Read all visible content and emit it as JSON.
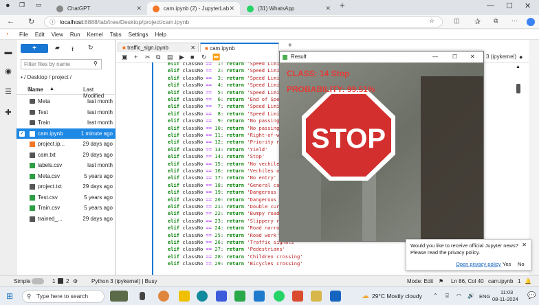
{
  "browser": {
    "tabs": [
      {
        "label": "ChatGPT",
        "active": false
      },
      {
        "label": "cam.ipynb (2) - JupyterLab",
        "active": true
      },
      {
        "label": "(31) WhatsApp",
        "active": false
      }
    ],
    "url_host": "localhost",
    "url_path": ":8888/lab/tree/Desktop/project/cam.ipynb"
  },
  "menu": [
    "File",
    "Edit",
    "View",
    "Run",
    "Kernel",
    "Tabs",
    "Settings",
    "Help"
  ],
  "filebrowser": {
    "new_label": "+",
    "filter_placeholder": "Filter files by name",
    "breadcrumb": "/ Desktop / project /",
    "col_name": "Name",
    "col_modified": "Last Modified",
    "files": [
      {
        "name": "Meta",
        "modified": "last month",
        "type": "folder",
        "selected": false
      },
      {
        "name": "Test",
        "modified": "last month",
        "type": "folder",
        "selected": false
      },
      {
        "name": "Train",
        "modified": "last month",
        "type": "folder",
        "selected": false
      },
      {
        "name": "cam.ipynb",
        "modified": "1 minute ago",
        "type": "notebook",
        "selected": true
      },
      {
        "name": "project.ip...",
        "modified": "29 days ago",
        "type": "notebook",
        "selected": false
      },
      {
        "name": "cam.txt",
        "modified": "29 days ago",
        "type": "text",
        "selected": false
      },
      {
        "name": "labels.csv",
        "modified": "last month",
        "type": "csv",
        "selected": false
      },
      {
        "name": "Meta.csv",
        "modified": "5 years ago",
        "type": "csv",
        "selected": false
      },
      {
        "name": "project.txt",
        "modified": "29 days ago",
        "type": "text",
        "selected": false
      },
      {
        "name": "Test.csv",
        "modified": "5 years ago",
        "type": "csv",
        "selected": false
      },
      {
        "name": "Train.csv",
        "modified": "5 years ago",
        "type": "csv",
        "selected": false
      },
      {
        "name": "trained_...",
        "modified": "29 days ago",
        "type": "text",
        "selected": false
      }
    ]
  },
  "notebook": {
    "tabs": [
      "traffic_sign.ipynb",
      "cam.ipynb"
    ],
    "kernel_label": "3 (ipykernel)",
    "code_lines": [
      {
        "n": "1",
        "label": "'Speed Limit 30"
      },
      {
        "n": "2",
        "label": "'Speed Limit 50"
      },
      {
        "n": "3",
        "label": "'Speed Limit 60"
      },
      {
        "n": "4",
        "label": "'Speed Limit 70"
      },
      {
        "n": "5",
        "label": "'Speed Limit 80"
      },
      {
        "n": "6",
        "label": "'End of Speed L"
      },
      {
        "n": "7",
        "label": "'Speed Limit 10"
      },
      {
        "n": "8",
        "label": "'Speed Limit 12"
      },
      {
        "n": "9",
        "label": "'No passing'"
      },
      {
        "n": "10",
        "label": "'No passing fo"
      },
      {
        "n": "11",
        "label": "'Right-of-way"
      },
      {
        "n": "12",
        "label": "'Priority road"
      },
      {
        "n": "13",
        "label": "'Yield'"
      },
      {
        "n": "14",
        "label": "'Stop'"
      },
      {
        "n": "15",
        "label": "'No vechiles'"
      },
      {
        "n": "16",
        "label": "'Vechiles over"
      },
      {
        "n": "17",
        "label": "'No entry'"
      },
      {
        "n": "18",
        "label": "'General cauti"
      },
      {
        "n": "19",
        "label": "'Dangerous cur"
      },
      {
        "n": "20",
        "label": "'Dangerous cur"
      },
      {
        "n": "21",
        "label": "'Double curve'"
      },
      {
        "n": "22",
        "label": "'Bumpy road'"
      },
      {
        "n": "23",
        "label": "'Slippery road"
      },
      {
        "n": "24",
        "label": "'Road narrows"
      },
      {
        "n": "25",
        "label": "'Road work'"
      },
      {
        "n": "26",
        "label": "'Traffic signals'"
      },
      {
        "n": "27",
        "label": "'Pedestrians'"
      },
      {
        "n": "28",
        "label": "'Children crossing'"
      },
      {
        "n": "29",
        "label": "'Bicycles crossing'"
      }
    ]
  },
  "result_window": {
    "title": "Result",
    "class_text": "CLASS:  14 Stop",
    "prob_text": "PROBABILITY: 99.51%",
    "sign_text": "STOP"
  },
  "notification": {
    "message": "Would you like to receive official Jupyter news? Please read the privacy policy.",
    "link": "Open privacy policy",
    "yes": "Yes",
    "no": "No"
  },
  "status": {
    "mode": "Simple",
    "count1": "1",
    "count2": "2",
    "kernel": "Python 3 (ipykernel) | Busy",
    "edit_mode": "Mode: Edit",
    "position": "Ln 86, Col 40",
    "file": "cam.ipynb",
    "bell": "1"
  },
  "taskbar": {
    "search_placeholder": "Type here to search",
    "weather": "29°C  Mostly cloudy",
    "lang": "ENG",
    "time": "11:03",
    "date": "08-11-2024"
  },
  "colors": {
    "accent": "#1976d2",
    "stop_red": "#d32f2f",
    "overlay_text": "#e53935"
  }
}
